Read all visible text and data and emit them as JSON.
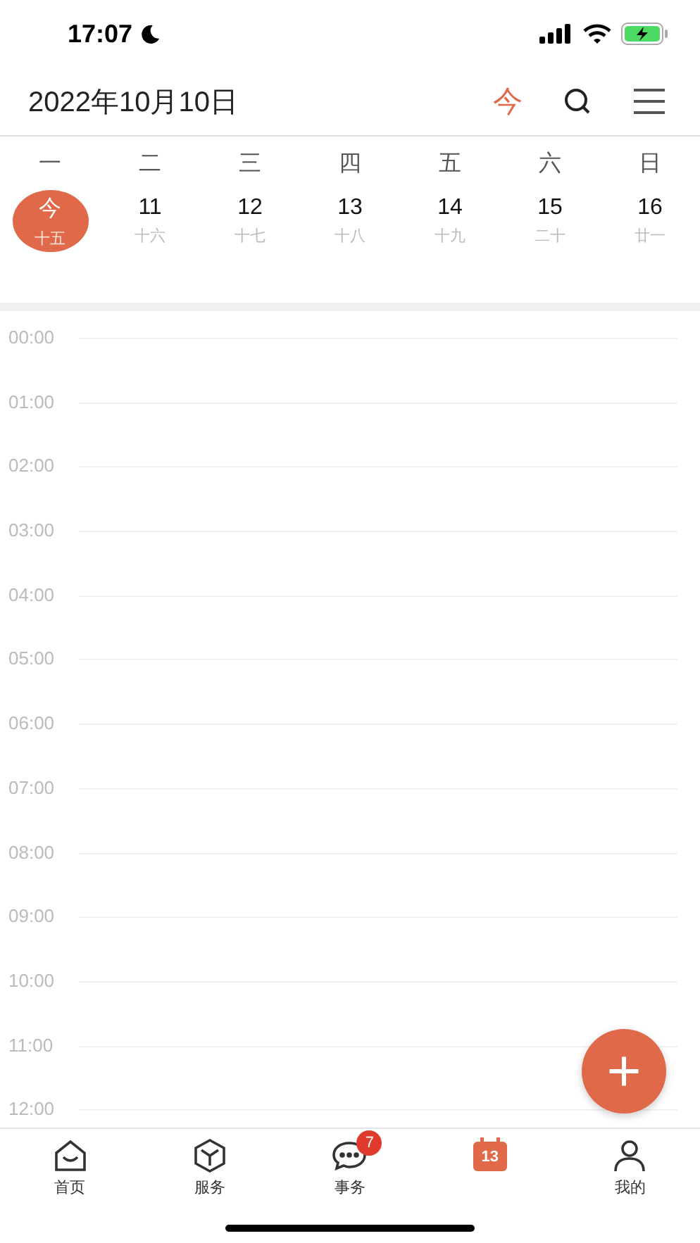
{
  "status_bar": {
    "time": "17:07"
  },
  "header": {
    "title": "2022年10月10日",
    "today_button": "今"
  },
  "week": {
    "weekdays": [
      "一",
      "二",
      "三",
      "四",
      "五",
      "六",
      "日"
    ],
    "days": [
      {
        "day": "今",
        "lunar": "十五",
        "selected": true
      },
      {
        "day": "11",
        "lunar": "十六",
        "selected": false
      },
      {
        "day": "12",
        "lunar": "十七",
        "selected": false
      },
      {
        "day": "13",
        "lunar": "十八",
        "selected": false
      },
      {
        "day": "14",
        "lunar": "十九",
        "selected": false
      },
      {
        "day": "15",
        "lunar": "二十",
        "selected": false
      },
      {
        "day": "16",
        "lunar": "廿一",
        "selected": false
      }
    ]
  },
  "timeline": {
    "hours": [
      "00:00",
      "01:00",
      "02:00",
      "03:00",
      "04:00",
      "05:00",
      "06:00",
      "07:00",
      "08:00",
      "09:00",
      "10:00",
      "11:00",
      "12:00"
    ]
  },
  "add_button": {
    "label": "+"
  },
  "tab_bar": [
    {
      "kind": "home",
      "label": "首页",
      "selected": false
    },
    {
      "kind": "service",
      "label": "服务",
      "selected": false
    },
    {
      "kind": "chat",
      "label": "事务",
      "badge": "7",
      "selected": false
    },
    {
      "kind": "calendar",
      "icon_text": "13",
      "selected": true
    },
    {
      "kind": "profile",
      "label": "我的",
      "selected": false
    }
  ]
}
